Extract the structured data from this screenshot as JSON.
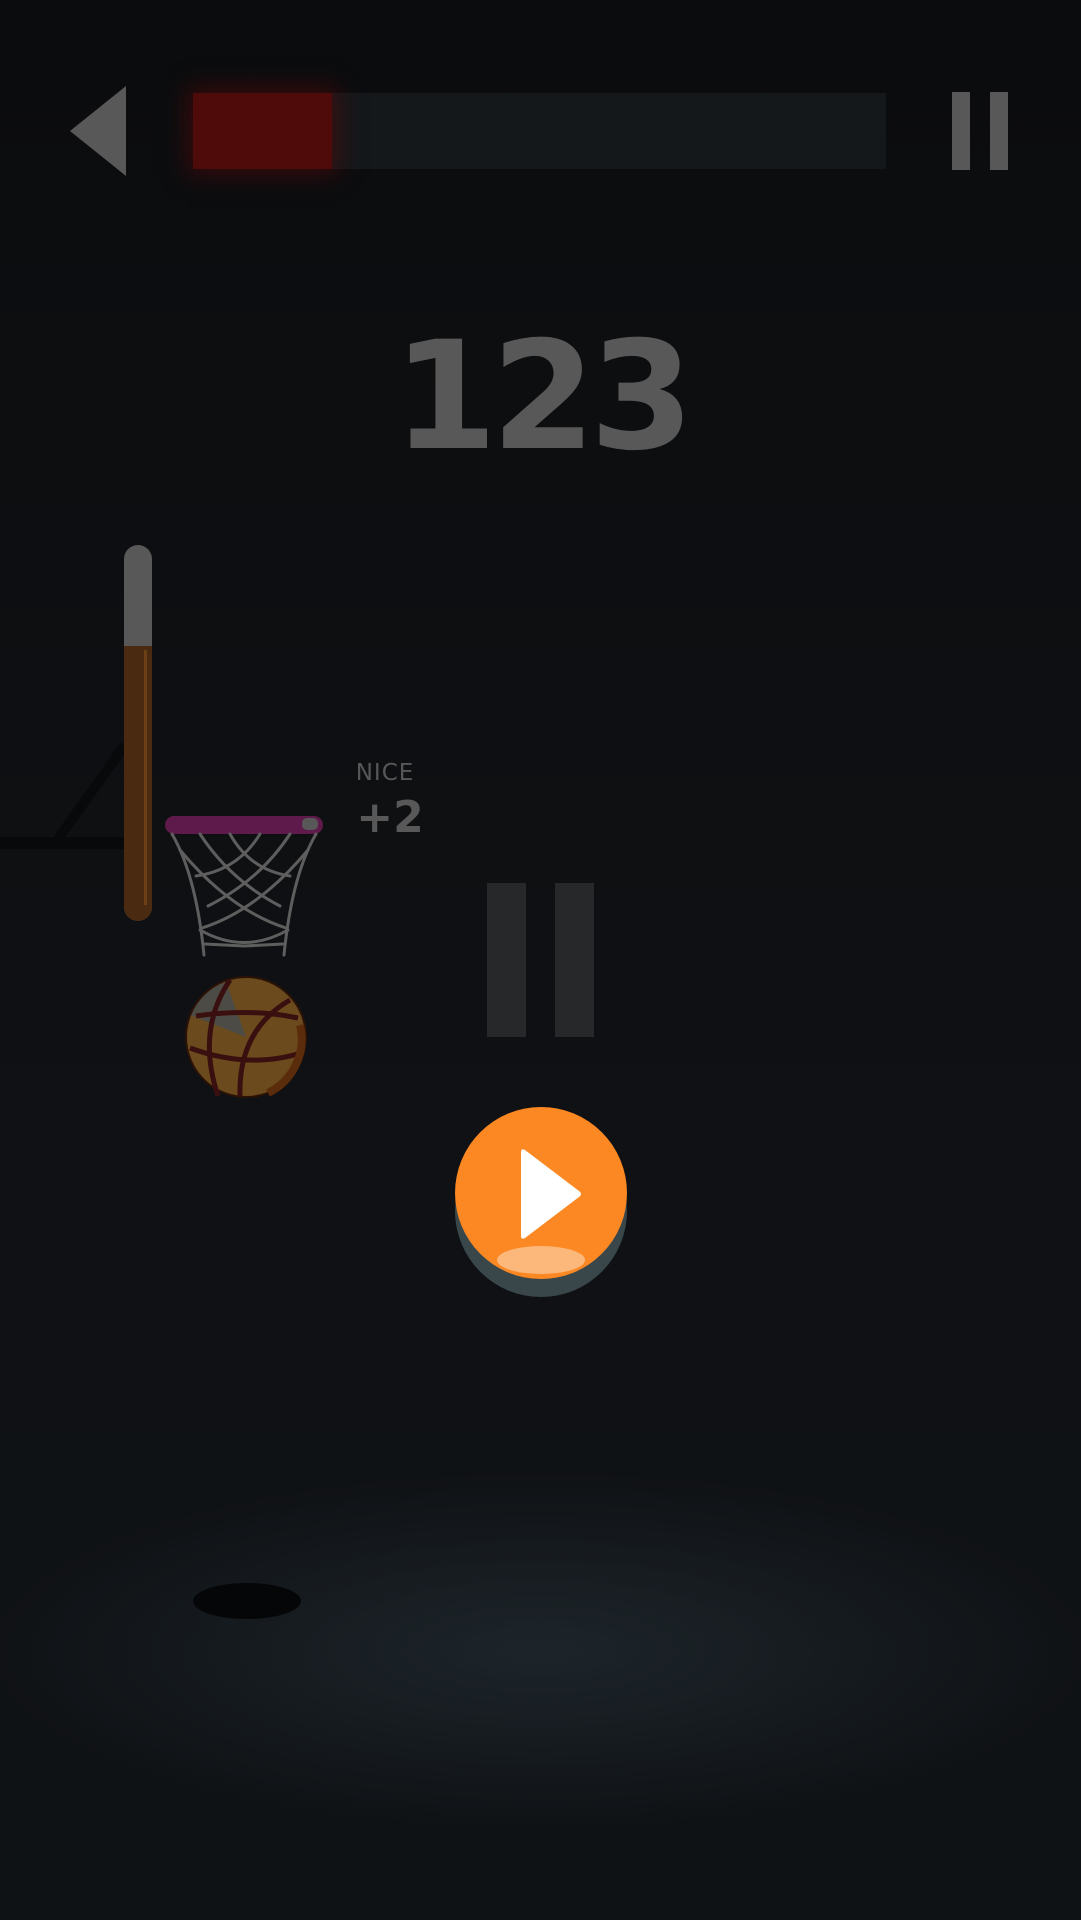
{
  "header": {
    "timer_fraction": 0.2,
    "timer_color": "#4f0a0a",
    "back_icon": "back-triangle-icon",
    "pause_icon": "pause-icon"
  },
  "game": {
    "score": "123",
    "feedback": {
      "label": "NICE",
      "points": "+2"
    },
    "state": "paused",
    "power_meter_fraction": 0.73
  },
  "overlay": {
    "pause_icon": "pause-icon",
    "play_icon": "play-icon",
    "play_color": "#fb8823"
  },
  "colors": {
    "background": "#0d0f12",
    "rim": "#5e1a4a",
    "ball": "#6b4b1e",
    "meter_fill": "#4a2a10",
    "meter_empty": "#585858"
  }
}
